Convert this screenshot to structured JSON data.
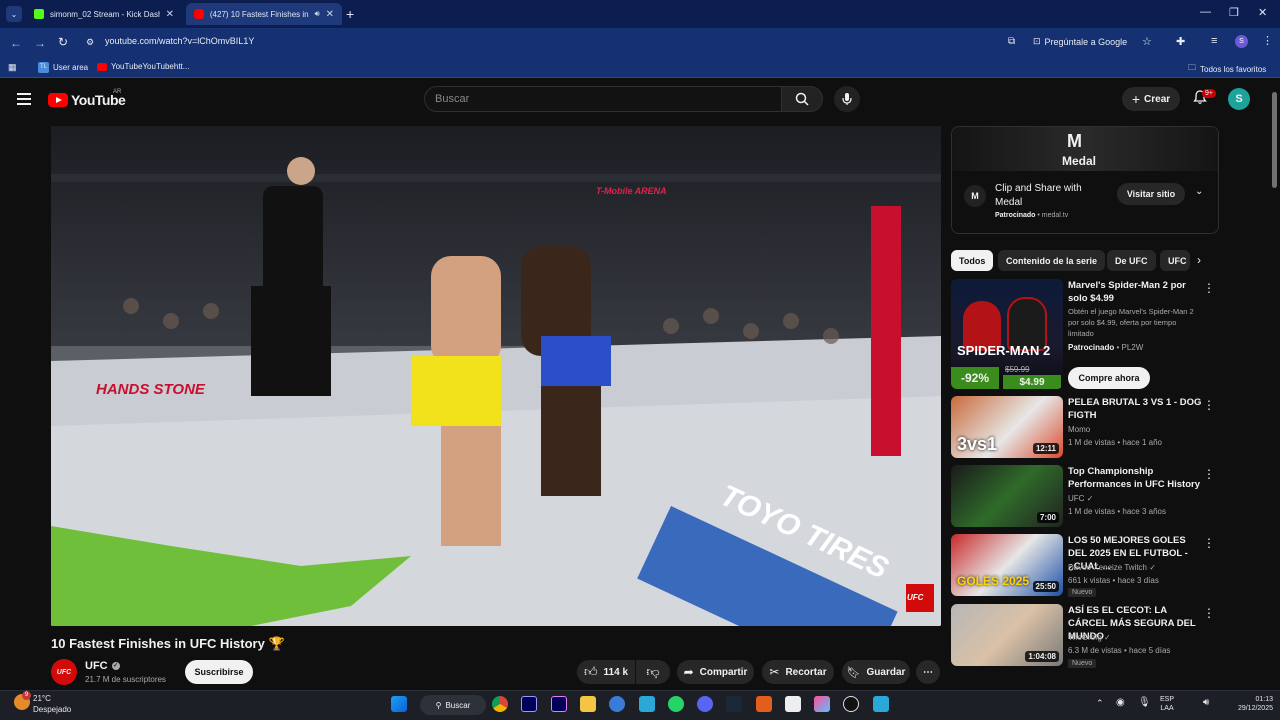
{
  "browser": {
    "tabs": [
      {
        "title": "simonm_02 Stream - Kick Dashb",
        "close": "✕"
      },
      {
        "title": "(427) 10 Fastest Finishes in",
        "close": "✕"
      }
    ],
    "new_tab": "+",
    "url": "youtube.com/watch?v=lChOmvBIL1Y",
    "ask_google": "Pregúntale a Google",
    "profile_initial": "S",
    "bookmarks": [
      {
        "label": "User area"
      },
      {
        "label": "YouTubeYouTubehtt..."
      }
    ],
    "all_favorites": "Todos los favoritos"
  },
  "youtube": {
    "logo_text": "YouTube",
    "country": "AR",
    "search_placeholder": "Buscar",
    "create_label": "Crear",
    "notifications_badge": "9+",
    "avatar_initial": "S"
  },
  "video": {
    "title": "10 Fastest Finishes in UFC History 🏆",
    "channel": "UFC",
    "channel_logo": "UFC",
    "subscribers": "21.7 M de suscriptores",
    "subscribe_label": "Subscribe",
    "subscribe_text": "Suscribirse",
    "likes": "114 k",
    "share_label": "Compartir",
    "clip_label": "Recortar",
    "save_label": "Guardar",
    "overlay": {
      "arena_text": "T-Mobile ARENA",
      "hands_stone": "HANDS STONE",
      "toyo": "TOYO TIRES",
      "ufc_corner": "UFC"
    }
  },
  "ad": {
    "brand": "Medal",
    "title": "Clip and Share with Medal",
    "sponsored": "Patrocinado",
    "domain": "medal.tv",
    "visit_label": "Visitar sitio"
  },
  "chips": [
    {
      "label": "Todos",
      "active": true
    },
    {
      "label": "Contenido de la serie",
      "active": false
    },
    {
      "label": "De UFC",
      "active": false
    },
    {
      "label": "UFC",
      "active": false
    }
  ],
  "recommendations": [
    {
      "title": "Marvel's Spider-Man 2 por solo $4.99",
      "description": "Obtén el juego Marvel's Spider-Man 2 por solo $4.99, oferta por tiempo limitado",
      "sponsor": "Patrocinado",
      "advertiser": "PL2W",
      "thumb_text": "SPIDER-MAN 2",
      "discount": "-92%",
      "old_price": "$59.99",
      "price": "$4.99",
      "cta": "Compre ahora"
    },
    {
      "title": "PELEA BRUTAL 3 VS 1 - DOG FIGTH",
      "channel": "Momo",
      "meta": "1 M de vistas • hace 1 año",
      "duration": "12:11",
      "thumb_text": "3vs1"
    },
    {
      "title": "Top Championship Performances in UFC History",
      "channel": "UFC",
      "meta": "1 M de vistas • hace 3 años",
      "duration": "7:00"
    },
    {
      "title": "LOS 50 MEJORES GOLES DEL 2025 EN EL FUTBOL - ¿CUAL ...",
      "channel": "Davoo Xeneize Twitch",
      "meta": "661 k vistas • hace 3 días",
      "duration": "25:50",
      "badge": "Nuevo",
      "thumb_text": "GOLES 2025"
    },
    {
      "title": "ASÍ ES EL CECOT: LA CÁRCEL MÁS SEGURA DEL MUNDO",
      "channel": "TheGrefg",
      "meta": "6.3 M de vistas • hace 5 días",
      "duration": "1:04:08",
      "badge": "Nuevo"
    }
  ],
  "taskbar": {
    "temperature": "21°C",
    "weather": "Despejado",
    "weather_badge": "9",
    "search_label": "Buscar",
    "lang_top": "ESP",
    "lang_bottom": "LAA",
    "time": "01:13",
    "date": "29/12/2025"
  },
  "colors": {
    "brand_red": "#ff0000",
    "chrome_blue": "#0b1e4f",
    "background": "#0f0f0f"
  }
}
